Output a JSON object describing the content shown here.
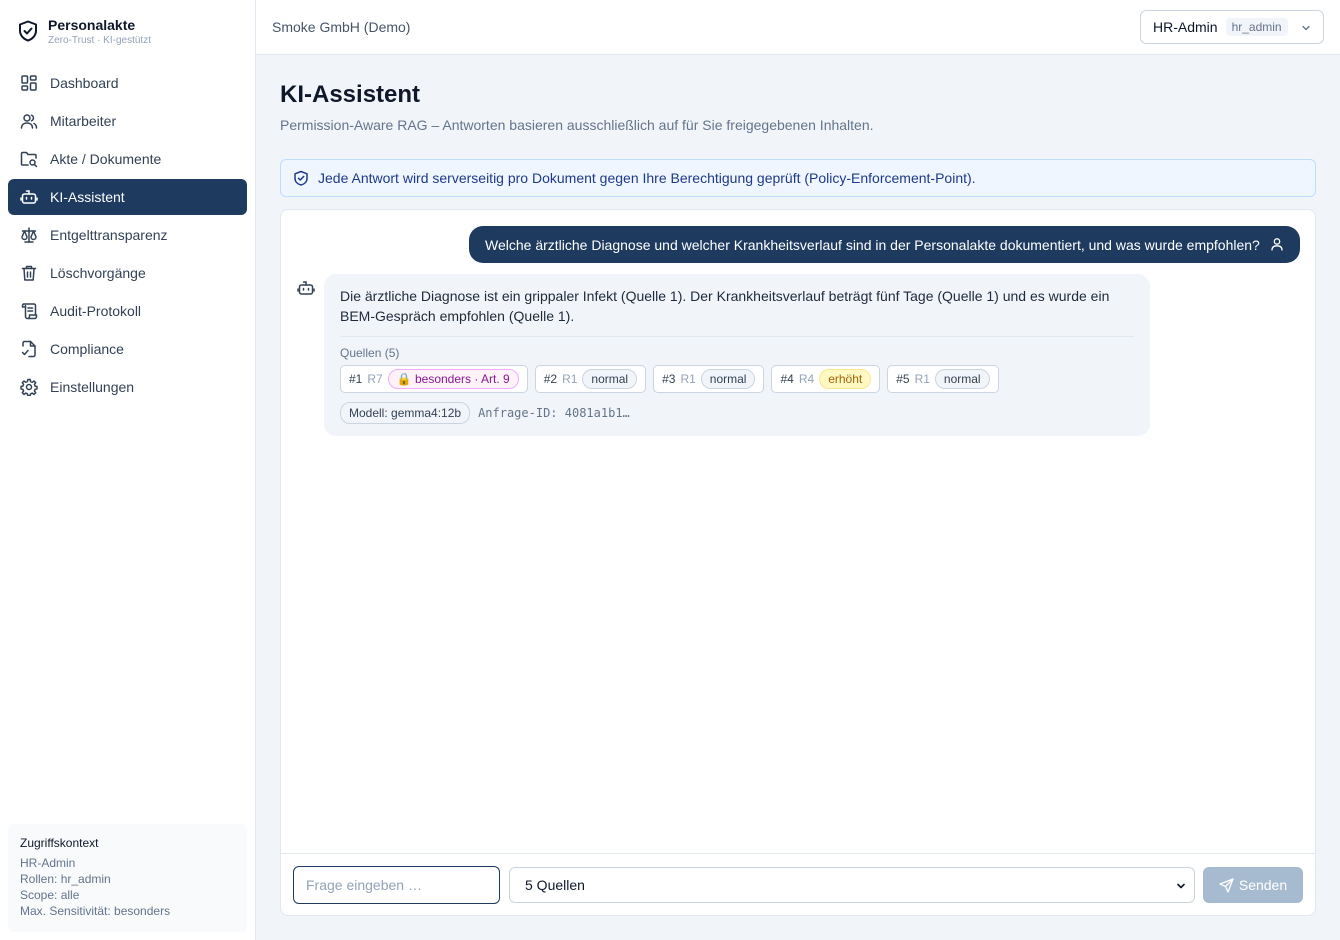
{
  "brand": {
    "title": "Personalakte",
    "subtitle": "Zero-Trust · KI-gestützt"
  },
  "sidebar": {
    "items": [
      {
        "label": "Dashboard",
        "icon": "dashboard-icon"
      },
      {
        "label": "Mitarbeiter",
        "icon": "users-icon"
      },
      {
        "label": "Akte / Dokumente",
        "icon": "folder-search-icon"
      },
      {
        "label": "KI-Assistent",
        "icon": "bot-icon",
        "active": true
      },
      {
        "label": "Entgelttransparenz",
        "icon": "scale-icon"
      },
      {
        "label": "Löschvorgänge",
        "icon": "trash-icon"
      },
      {
        "label": "Audit-Protokoll",
        "icon": "scroll-icon"
      },
      {
        "label": "Compliance",
        "icon": "file-check-icon"
      },
      {
        "label": "Einstellungen",
        "icon": "gear-icon"
      }
    ],
    "context": {
      "title": "Zugriffskontext",
      "user": "HR-Admin",
      "roles": "Rollen: hr_admin",
      "scope": "Scope: alle",
      "sensitivity": "Max. Sensitivität: besonders"
    }
  },
  "header": {
    "tenant": "Smoke GmbH (Demo)",
    "user_name": "HR-Admin",
    "user_role": "hr_admin"
  },
  "page": {
    "title": "KI-Assistent",
    "subtitle": "Permission-Aware RAG – Antworten basieren ausschließlich auf für Sie freigegebenen Inhalten.",
    "notice": "Jede Antwort wird serverseitig pro Dokument gegen Ihre Berechtigung geprüft (Policy-Enforcement-Point)."
  },
  "chat": {
    "user_message": "Welche ärztliche Diagnose und welcher Krankheitsverlauf sind in der Personalakte dokumentiert, und was wurde empfohlen?",
    "answer": "Die ärztliche Diagnose ist ein grippaler Infekt (Quelle 1). Der Krankheitsverlauf beträgt fünf Tage (Quelle 1) und es wurde ein BEM-Gespräch empfohlen (Quelle 1).",
    "sources_title": "Quellen (5)",
    "sources": [
      {
        "num": "#1",
        "rank": "R7",
        "tag": "🔒 besonders · Art. 9",
        "level": "special"
      },
      {
        "num": "#2",
        "rank": "R1",
        "tag": "normal",
        "level": "normal"
      },
      {
        "num": "#3",
        "rank": "R1",
        "tag": "normal",
        "level": "normal"
      },
      {
        "num": "#4",
        "rank": "R4",
        "tag": "erhöht",
        "level": "high"
      },
      {
        "num": "#5",
        "rank": "R1",
        "tag": "normal",
        "level": "normal"
      }
    ],
    "model": "Modell: gemma4:12b",
    "request_id": "Anfrage-ID: 4081a1b1…"
  },
  "composer": {
    "placeholder": "Frage eingeben …",
    "sources_select": "5 Quellen",
    "send_label": "Senden"
  },
  "colors": {
    "primary": "#1e3a5f",
    "notice_bg": "#eff6ff",
    "special_tag": "#86198f",
    "high_tag": "#a16207",
    "send_disabled": "#a7bbd0"
  }
}
